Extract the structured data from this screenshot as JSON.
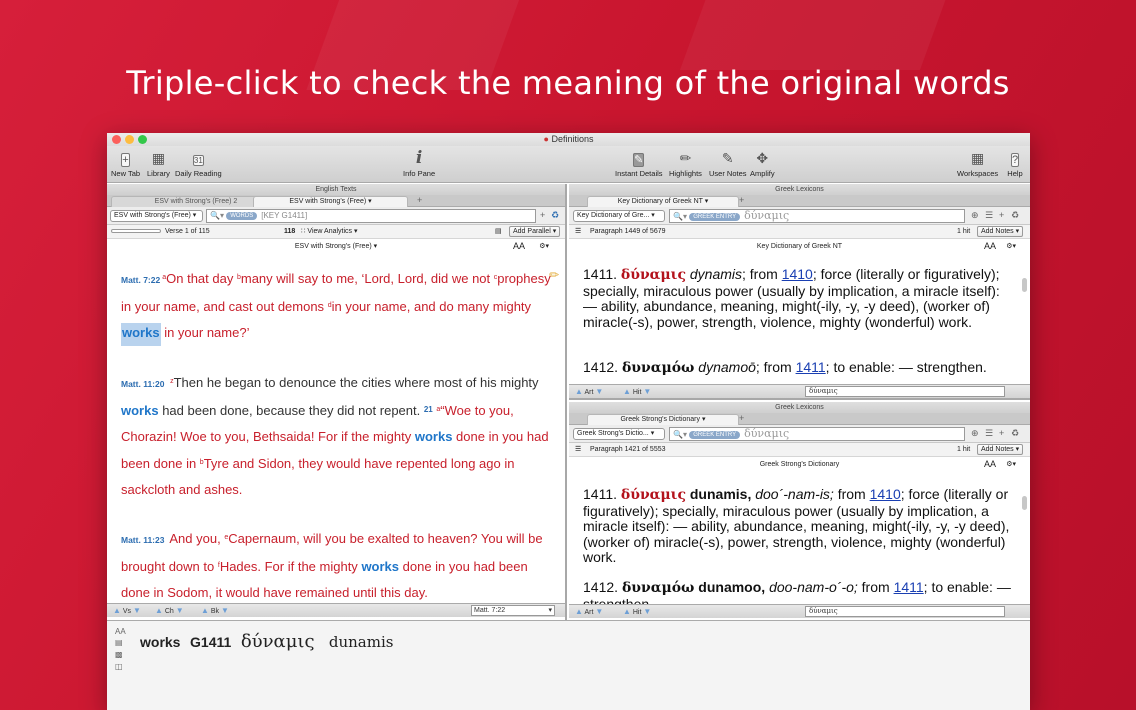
{
  "headline": "Triple-click to check the meaning of the original words",
  "window_title": "Definitions",
  "toolbar": {
    "new_tab": "New Tab",
    "library": "Library",
    "daily_reading": "Daily Reading",
    "info_pane": "Info Pane",
    "instant_details": "Instant Details",
    "highlights": "Highlights",
    "user_notes": "User Notes",
    "amplify": "Amplify",
    "workspaces": "Workspaces",
    "help": "Help",
    "daily_reading_day": "31"
  },
  "left": {
    "pane_title": "English Texts",
    "tabs": [
      "ESV with Strong's (Free) 2",
      "ESV with Strong's (Free)"
    ],
    "module_select": "ESV with Strong's (Free)",
    "search_pill": "WORDS",
    "search_query": "[KEY G1411]",
    "verse_info": "Verse 1 of 115",
    "count": "118",
    "view_analytics": "View Analytics",
    "add_parallel": "Add Parallel",
    "subtitle": "ESV with Strong's (Free)",
    "passages": [
      {
        "ref": "Matt. 7:22",
        "a": "On that day ",
        "b": "many will say to me, ‘Lord, Lord, did we not ",
        "c": "prophesy in your name, and cast out demons ",
        "d": "in your name, and do many mighty ",
        "w": "works",
        "e": " in your name?’"
      },
      {
        "ref": "Matt. 11:20",
        "a": "Then he began to denounce the cities where most of his mighty ",
        "w1": "works",
        "b": " had been done, because they did not repent. ",
        "vn": "21",
        "c": "“Woe to you, Chorazin! Woe to you, Bethsaida! For if the mighty ",
        "w2": "works",
        "d": " done in you had been done in ",
        "e": "Tyre and Sidon, they would have repented long ago in sackcloth and ashes."
      },
      {
        "ref": "Matt. 11:23",
        "a": "And you, ",
        "b": "Capernaum, will you be exalted to heaven? You will be brought down to ",
        "c": "Hades. For if the mighty ",
        "w": "works",
        "d": " done in you had been done in Sodom, it would have remained until this day."
      }
    ],
    "nav": {
      "vs": "Vs",
      "ch": "Ch",
      "bk": "Bk",
      "ref": "Matt. 7:22"
    }
  },
  "top_right": {
    "pane_title": "Greek Lexicons",
    "tab": "Key Dictionary of Greek NT",
    "module_select": "Key Dictionary of Gre...",
    "search_pill": "GREEK ENTRY",
    "search_query": "δύναμις",
    "paragraph_info": "Paragraph 1449 of 5679",
    "hits": "1 hit",
    "add_notes": "Add Notes",
    "subtitle": "Key Dictionary of Greek NT",
    "entry1": {
      "num": "1411.",
      "greek": "δύναμις",
      "translit": "dynamis",
      "pre": "; from ",
      "link": "1410",
      "body": "; force (literally or figuratively); specially, miraculous power (usually by implication, a miracle itself): — ability, abundance, meaning, might(-ily, -y, -y deed), (worker of) miracle(-s), power, strength, violence, mighty (wonderful) work."
    },
    "entry2": {
      "num": "1412.",
      "greek": "δυναμόω",
      "translit": "dynamoō",
      "pre": "; from ",
      "link": "1411",
      "body": "; to enable: — strengthen."
    },
    "nav": {
      "art": "Art",
      "hit": "Hit",
      "field": "δύναμις"
    }
  },
  "bottom_right": {
    "pane_title": "Greek Lexicons",
    "tab": "Greek Strong's Dictionary",
    "module_select": "Greek Strong's Dictio...",
    "search_pill": "GREEK ENTRY",
    "search_query": "δύναμις",
    "paragraph_info": "Paragraph 1421 of 5553",
    "hits": "1 hit",
    "add_notes": "Add Notes",
    "subtitle": "Greek Strong's Dictionary",
    "entry1": {
      "num": "1411.",
      "greek": "δύναμις",
      "translit": "dunamis,",
      "pron": "doo´-nam-is;",
      "pre": " from ",
      "link": "1410",
      "body": "; force (literally or figuratively); specially, miraculous power (usually by implication, a miracle itself): — ability, abundance, meaning, might(-ily, -y, -y deed), (worker of) miracle(-s), power, strength, violence, mighty (wonderful) work."
    },
    "entry2": {
      "num": "1412.",
      "greek": "δυναμόω",
      "translit": "dunamoo,",
      "pron": "doo-nam-o´-o;",
      "pre": " from ",
      "link": "1411",
      "body": "; to enable: — strengthen."
    },
    "nav": {
      "art": "Art",
      "hit": "Hit",
      "field": "δύναμις"
    }
  },
  "info_pane": {
    "word": "works",
    "strongs": "G1411",
    "greek": "δύναμις",
    "translit": "dunamis"
  },
  "colors": {
    "background": "#c9162f",
    "words_of_christ": "#c8202c",
    "highlight": "#1f76c9",
    "greek_headword": "#b3121b"
  }
}
